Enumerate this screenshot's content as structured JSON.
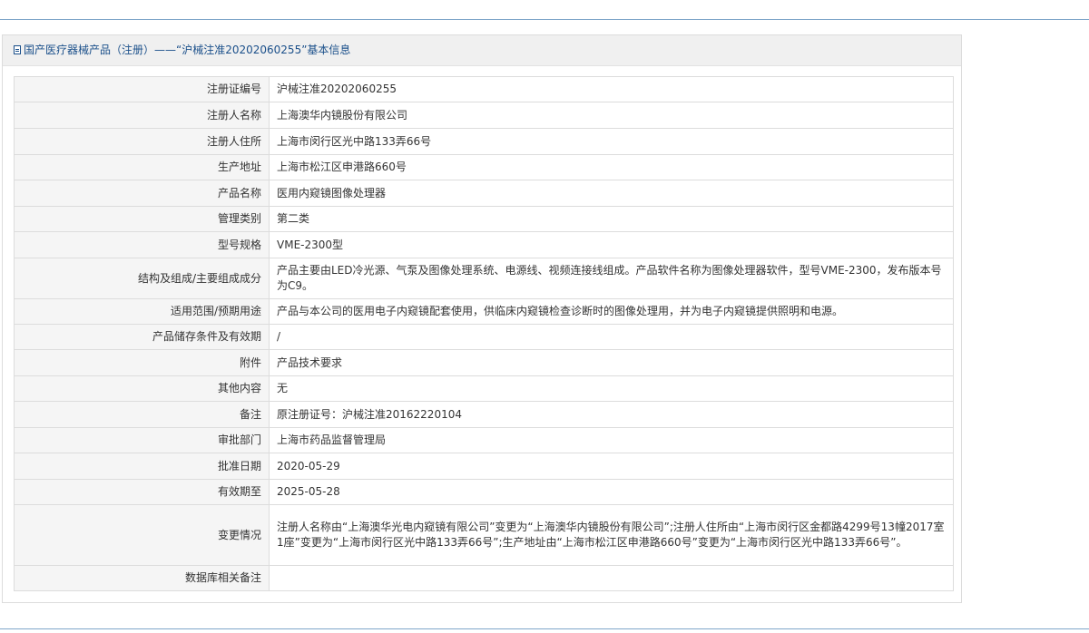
{
  "header": {
    "title": "国产医疗器械产品（注册）——“沪械注准20202060255”基本信息"
  },
  "rows": [
    {
      "label": "注册证编号",
      "value": "沪械注准20202060255"
    },
    {
      "label": "注册人名称",
      "value": "上海澳华内镜股份有限公司"
    },
    {
      "label": "注册人住所",
      "value": "上海市闵行区光中路133弄66号"
    },
    {
      "label": "生产地址",
      "value": "上海市松江区申港路660号"
    },
    {
      "label": "产品名称",
      "value": "医用内窥镜图像处理器"
    },
    {
      "label": "管理类别",
      "value": "第二类"
    },
    {
      "label": "型号规格",
      "value": "VME-2300型"
    },
    {
      "label": "结构及组成/主要组成成分",
      "value": "产品主要由LED冷光源、气泵及图像处理系统、电源线、视频连接线组成。产品软件名称为图像处理器软件，型号VME-2300，发布版本号为C9。"
    },
    {
      "label": "适用范围/预期用途",
      "value": "产品与本公司的医用电子内窥镜配套使用，供临床内窥镜检查诊断时的图像处理用，并为电子内窥镜提供照明和电源。"
    },
    {
      "label": "产品储存条件及有效期",
      "value": "/"
    },
    {
      "label": "附件",
      "value": "产品技术要求"
    },
    {
      "label": "其他内容",
      "value": "无"
    },
    {
      "label": "备注",
      "value": "原注册证号：沪械注准20162220104"
    },
    {
      "label": "审批部门",
      "value": "上海市药品监督管理局"
    },
    {
      "label": "批准日期",
      "value": "2020-05-29"
    },
    {
      "label": "有效期至",
      "value": "2025-05-28"
    },
    {
      "label": "变更情况",
      "value": "注册人名称由“上海澳华光电内窥镜有限公司”变更为“上海澳华内镜股份有限公司”;注册人住所由“上海市闵行区金都路4299号13幢2017室1座”变更为“上海市闵行区光中路133弄66号”;生产地址由“上海市松江区申港路660号”变更为“上海市闵行区光中路133弄66号”。"
    },
    {
      "label": "数据库相关备注",
      "value": ""
    }
  ]
}
